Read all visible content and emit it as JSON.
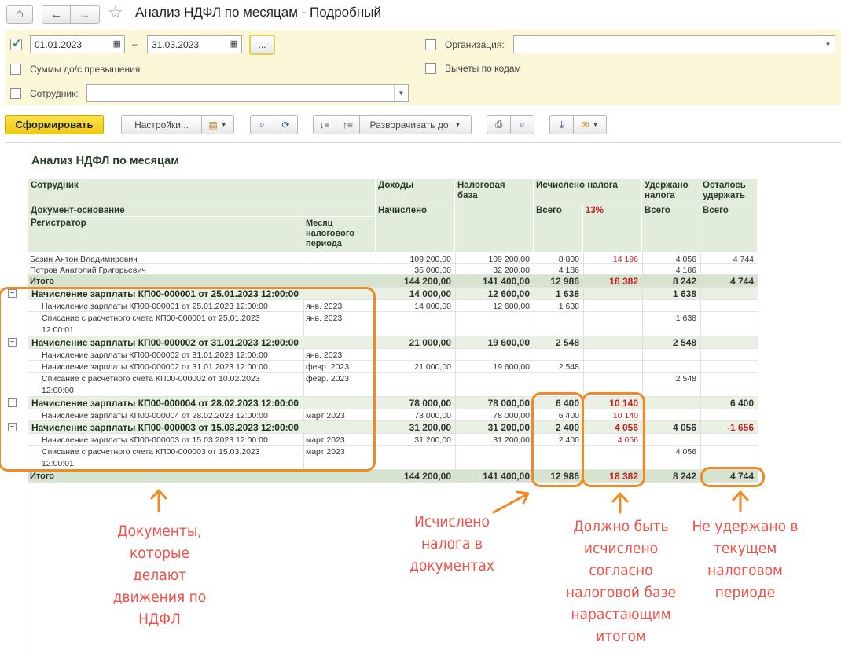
{
  "window": {
    "title": "Анализ НДФЛ по месяцам - Подробный",
    "home": "⌂",
    "back": "←",
    "forward": "→",
    "star": "☆"
  },
  "filter": {
    "date_from": "01.01.2023",
    "date_to": "31.03.2023",
    "dash": "–",
    "period_btn": "...",
    "sums_label": "Суммы до/с превышения",
    "employee_label": "Сотрудник:",
    "employee_value": "",
    "org_label": "Организация:",
    "org_value": "",
    "deductions_label": "Вычеты по кодам"
  },
  "toolbar": {
    "form": "Сформировать",
    "settings": "Настройки...",
    "expand": "Разворачивать до"
  },
  "report": {
    "title": "Анализ НДФЛ по месяцам",
    "headers": {
      "employee": "Сотрудник",
      "doc_basis": "Документ-основание",
      "registrar": "Регистратор",
      "month": "Месяц налогового периода",
      "income": "Доходы",
      "accrued": "Начислено",
      "tax_base": "Налоговая база",
      "calc_tax": "Исчислено налога",
      "total": "Всего",
      "pct13": "13%",
      "withheld": "Удержано налога",
      "withheld_total": "Всего",
      "remain": "Осталось удержать",
      "remain_total": "Всего"
    },
    "rows": [
      {
        "type": "plain",
        "name": "Базин Антон Владимирович",
        "month": "",
        "income": "109 200,00",
        "base": "109 200,00",
        "calc": "8 800",
        "p13": "14 196",
        "withheld": "4 056",
        "remain": "4 744"
      },
      {
        "type": "plain",
        "name": "Петров Анатолий Григорьевич",
        "month": "",
        "income": "35 000,00",
        "base": "32 200,00",
        "calc": "4 186",
        "p13": "",
        "withheld": "4 186",
        "remain": ""
      },
      {
        "type": "total",
        "name": "Итого",
        "month": "",
        "income": "144 200,00",
        "base": "141 400,00",
        "calc": "12 986",
        "p13": "18 382",
        "withheld": "8 242",
        "remain": "4 744"
      },
      {
        "type": "group",
        "name": "Начисление зарплаты КП00-000001 от 25.01.2023 12:00:00",
        "month": "",
        "income": "14 000,00",
        "base": "12 600,00",
        "calc": "1 638",
        "p13": "",
        "withheld": "1 638",
        "remain": ""
      },
      {
        "type": "detail",
        "name": "Начисление зарплаты КП00-000001 от 25.01.2023 12:00:00",
        "month": "янв. 2023",
        "income": "14 000,00",
        "base": "12 600,00",
        "calc": "1 638",
        "p13": "",
        "withheld": "",
        "remain": ""
      },
      {
        "type": "detail2",
        "name": "Списание с расчетного счета КП00-000001 от 25.01.2023",
        "name2": "12:00:01",
        "month": "янв. 2023",
        "income": "",
        "base": "",
        "calc": "",
        "p13": "",
        "withheld": "1 638",
        "remain": ""
      },
      {
        "type": "group",
        "name": "Начисление зарплаты КП00-000002 от 31.01.2023 12:00:00",
        "month": "",
        "income": "21 000,00",
        "base": "19 600,00",
        "calc": "2 548",
        "p13": "",
        "withheld": "2 548",
        "remain": ""
      },
      {
        "type": "detail",
        "name": "Начисление зарплаты КП00-000002 от 31.01.2023 12:00:00",
        "month": "янв. 2023",
        "income": "",
        "base": "",
        "calc": "",
        "p13": "",
        "withheld": "",
        "remain": ""
      },
      {
        "type": "detail",
        "name": "Начисление зарплаты КП00-000002 от 31.01.2023 12:00:00",
        "month": "февр. 2023",
        "income": "21 000,00",
        "base": "19 600,00",
        "calc": "2 548",
        "p13": "",
        "withheld": "",
        "remain": ""
      },
      {
        "type": "detail2",
        "name": "Списание с расчетного счета КП00-000002 от 10.02.2023",
        "name2": "12:00:00",
        "month": "февр. 2023",
        "income": "",
        "base": "",
        "calc": "",
        "p13": "",
        "withheld": "2 548",
        "remain": ""
      },
      {
        "type": "group",
        "name": "Начисление зарплаты КП00-000004 от 28.02.2023 12:00:00",
        "month": "",
        "income": "78 000,00",
        "base": "78 000,00",
        "calc": "6 400",
        "p13": "10 140",
        "withheld": "",
        "remain": "6 400"
      },
      {
        "type": "detail",
        "name": "Начисление зарплаты КП00-000004 от 28.02.2023 12:00:00",
        "month": "март 2023",
        "income": "78 000,00",
        "base": "78 000,00",
        "calc": "6 400",
        "p13": "10 140",
        "withheld": "",
        "remain": ""
      },
      {
        "type": "group",
        "name": "Начисление зарплаты КП00-000003 от 15.03.2023 12:00:00",
        "month": "",
        "income": "31 200,00",
        "base": "31 200,00",
        "calc": "2 400",
        "p13": "4 056",
        "withheld": "4 056",
        "remain": "-1 656"
      },
      {
        "type": "detail",
        "name": "Начисление зарплаты КП00-000003 от 15.03.2023 12:00:00",
        "month": "март 2023",
        "income": "31 200,00",
        "base": "31 200,00",
        "calc": "2 400",
        "p13": "4 056",
        "withheld": "",
        "remain": ""
      },
      {
        "type": "detail2",
        "name": "Списание с расчетного счета КП00-000003 от 15.03.2023",
        "name2": "12:00:01",
        "month": "март 2023",
        "income": "",
        "base": "",
        "calc": "",
        "p13": "",
        "withheld": "4 056",
        "remain": ""
      },
      {
        "type": "total",
        "name": "Итого",
        "month": "",
        "income": "144 200,00",
        "base": "141 400,00",
        "calc": "12 986",
        "p13": "18 382",
        "withheld": "8 242",
        "remain": "4 744"
      }
    ]
  },
  "annotations": {
    "docs": "Документы,\nкоторые\nделают\nдвижения по\nНДФЛ",
    "calc": "Исчислено\nналога в\nдокументах",
    "should": "Должно быть\nисчислено\nсогласно\nналоговой базе\nнарастающим\nитогом",
    "notwithheld": "Не удержано в\nтекущем\nналоговом\nпериоде"
  },
  "colors": {
    "annotation": "#f0524a",
    "highlight": "#f08a24",
    "header_bg": "#e1ecdb",
    "form_button": "#f2c913"
  }
}
